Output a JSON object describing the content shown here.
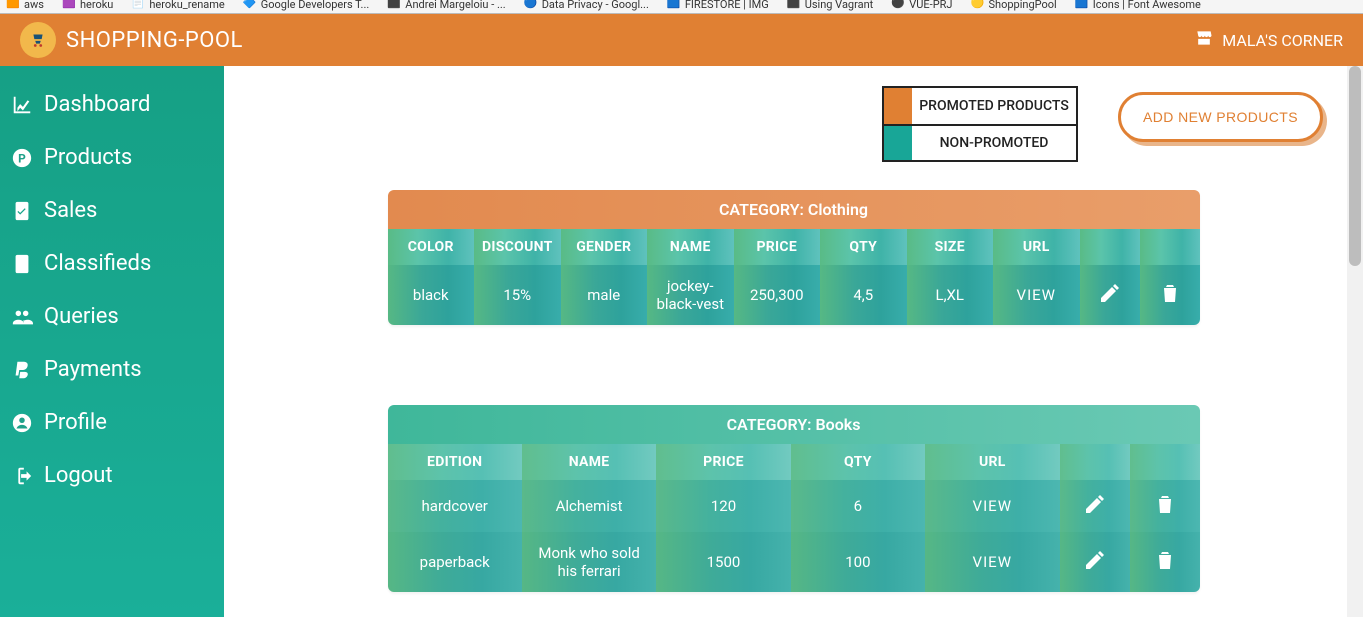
{
  "bookmarks": [
    {
      "label": "aws"
    },
    {
      "label": "heroku"
    },
    {
      "label": "heroku_rename"
    },
    {
      "label": "Google Developers T..."
    },
    {
      "label": "Andrei Margeloiu - ..."
    },
    {
      "label": "Data Privacy - Googl..."
    },
    {
      "label": "FIRESTORE | IMG"
    },
    {
      "label": "Using Vagrant"
    },
    {
      "label": "VUE-PRJ"
    },
    {
      "label": "ShoppingPool"
    },
    {
      "label": "Icons | Font Awesome"
    }
  ],
  "header": {
    "brand": "SHOPPING-POOL",
    "store": "MALA'S CORNER"
  },
  "sidebar": {
    "items": [
      {
        "label": "Dashboard"
      },
      {
        "label": "Products"
      },
      {
        "label": "Sales"
      },
      {
        "label": "Classifieds"
      },
      {
        "label": "Queries"
      },
      {
        "label": "Payments"
      },
      {
        "label": "Profile"
      },
      {
        "label": "Logout"
      }
    ]
  },
  "legend": {
    "promoted": "PROMOTED PRODUCTS",
    "nonpromoted": "NON-PROMOTED"
  },
  "add_button": "ADD NEW PRODUCTS",
  "categories": [
    {
      "title": "CATEGORY: Clothing",
      "kind": "clothing",
      "headers": [
        "COLOR",
        "DISCOUNT",
        "GENDER",
        "NAME",
        "PRICE",
        "QTY",
        "SIZE",
        "URL"
      ],
      "rows": [
        {
          "cells": [
            "black",
            "15%",
            "male",
            "jockey-black-vest",
            "250,300",
            "4,5",
            "L,XL",
            "VIEW"
          ]
        }
      ]
    },
    {
      "title": "CATEGORY: Books",
      "kind": "books",
      "headers": [
        "EDITION",
        "NAME",
        "PRICE",
        "QTY",
        "URL"
      ],
      "rows": [
        {
          "cells": [
            "hardcover",
            "Alchemist",
            "120",
            "6",
            "VIEW"
          ]
        },
        {
          "cells": [
            "paperback",
            "Monk who sold his ferrari",
            "1500",
            "100",
            "VIEW"
          ]
        }
      ]
    }
  ]
}
